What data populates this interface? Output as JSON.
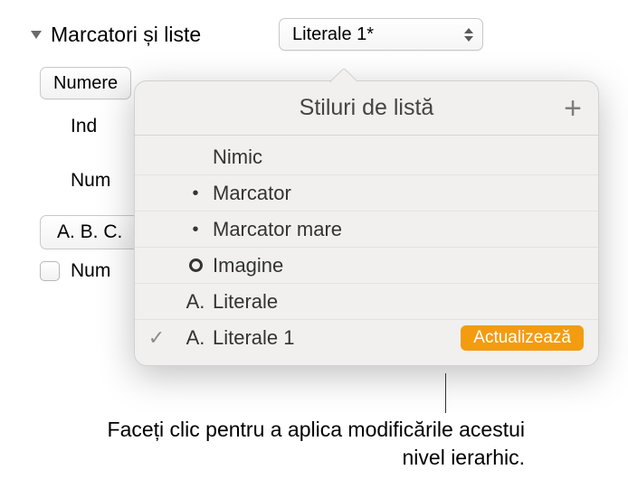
{
  "section": {
    "title": "Marcatori și liste"
  },
  "styleSelect": {
    "value": "Literale 1*"
  },
  "numbersBtn": {
    "label": "Numere"
  },
  "labels": {
    "indent": "Ind",
    "num": "Num"
  },
  "abcBtn": {
    "label": "A. B. C."
  },
  "checkbox": {
    "label": "Num"
  },
  "popover": {
    "title": "Stiluri de listă",
    "items": [
      {
        "name": "Nimic",
        "bullet": "",
        "checked": false
      },
      {
        "name": "Marcator",
        "bullet": "dot",
        "checked": false
      },
      {
        "name": "Marcator mare",
        "bullet": "dot",
        "checked": false
      },
      {
        "name": "Imagine",
        "bullet": "ring",
        "checked": false
      },
      {
        "name": "Literale",
        "bullet": "A.",
        "checked": false
      },
      {
        "name": "Literale 1",
        "bullet": "A.",
        "checked": true,
        "badge": "Actualizează"
      }
    ]
  },
  "callout": {
    "text": "Faceți clic pentru a aplica modificările acestui nivel ierarhic."
  }
}
